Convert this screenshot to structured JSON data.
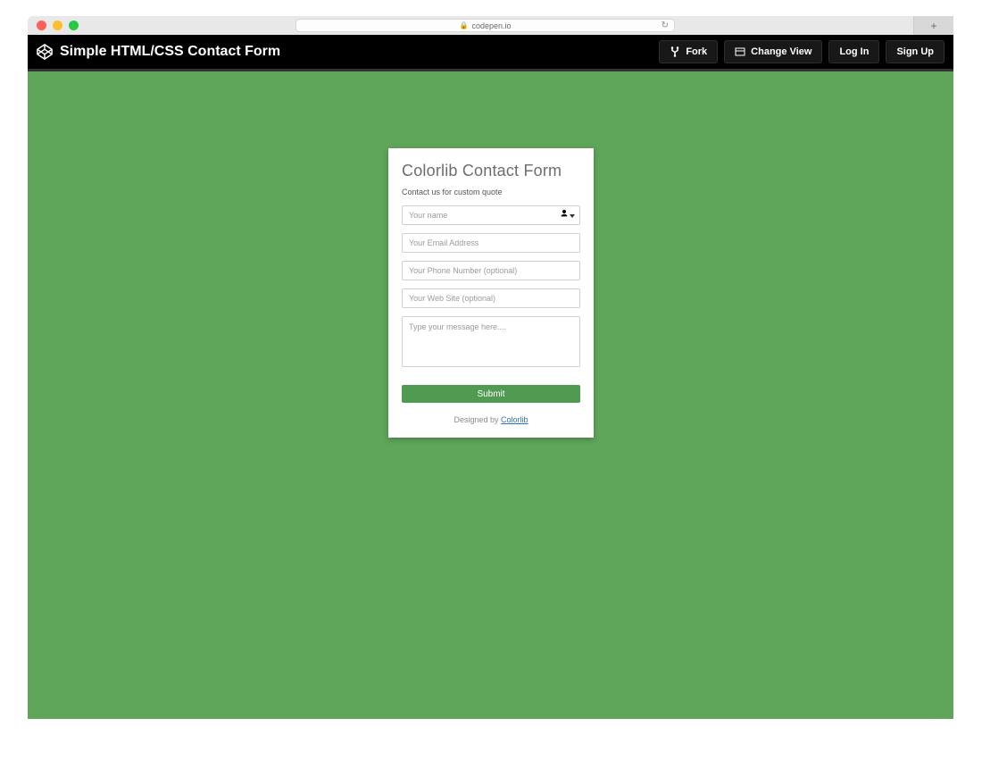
{
  "browser": {
    "url_host": "codepen.io"
  },
  "codepen": {
    "title": "Simple HTML/CSS Contact Form",
    "fork": "Fork",
    "change_view": "Change View",
    "log_in": "Log In",
    "sign_up": "Sign Up"
  },
  "form": {
    "title": "Colorlib Contact Form",
    "subtitle": "Contact us for custom quote",
    "name_placeholder": "Your name",
    "email_placeholder": "Your Email Address",
    "phone_placeholder": "Your Phone Number (optional)",
    "website_placeholder": "Your Web Site (optional)",
    "message_placeholder": "Type your message here....",
    "submit": "Submit",
    "credit_prefix": "Designed by ",
    "credit_link": "Colorlib"
  }
}
